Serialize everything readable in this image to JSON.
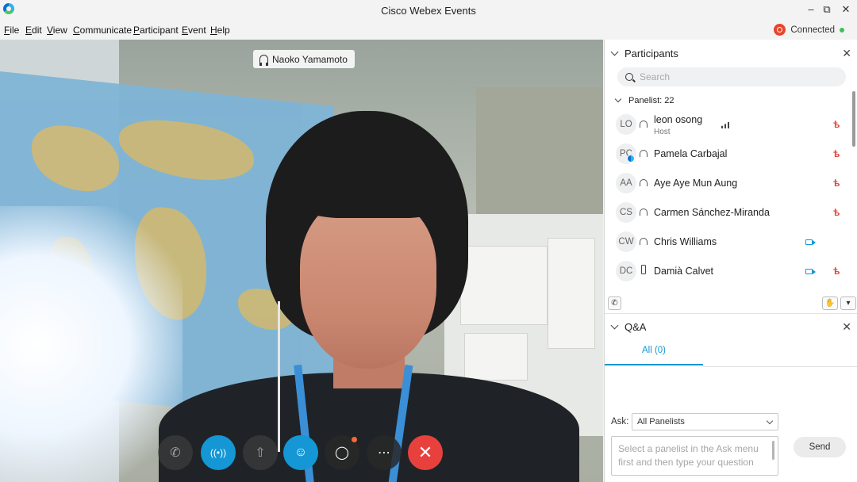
{
  "window": {
    "title": "Cisco Webex Events"
  },
  "menu": [
    "File",
    "Edit",
    "View",
    "Communicate",
    "Participant",
    "Event",
    "Help"
  ],
  "status": {
    "label": "Connected"
  },
  "video": {
    "active_speaker": "Naoko Yamamoto"
  },
  "participants_panel": {
    "title": "Participants",
    "search_placeholder": "Search",
    "group_label": "Panelist: 22",
    "list": [
      {
        "initials": "LO",
        "name": "leon osong",
        "role": "Host"
      },
      {
        "initials": "PC",
        "name": "Pamela Carbajal"
      },
      {
        "initials": "AA",
        "name": "Aye Aye Mun Aung"
      },
      {
        "initials": "CS",
        "name": "Carmen Sánchez-Miranda"
      },
      {
        "initials": "CW",
        "name": "Chris Williams"
      },
      {
        "initials": "DC",
        "name": "Damià Calvet"
      }
    ]
  },
  "qa_panel": {
    "title": "Q&A",
    "tab_all": "All (0)",
    "ask_label": "Ask:",
    "ask_value": "All Panelists",
    "question_placeholder": "Select a panelist in the Ask menu first and then type your question",
    "send_label": "Send"
  },
  "colors": {
    "accent": "#1497d4",
    "end_call": "#e8413d",
    "muted": "#e2463c"
  }
}
